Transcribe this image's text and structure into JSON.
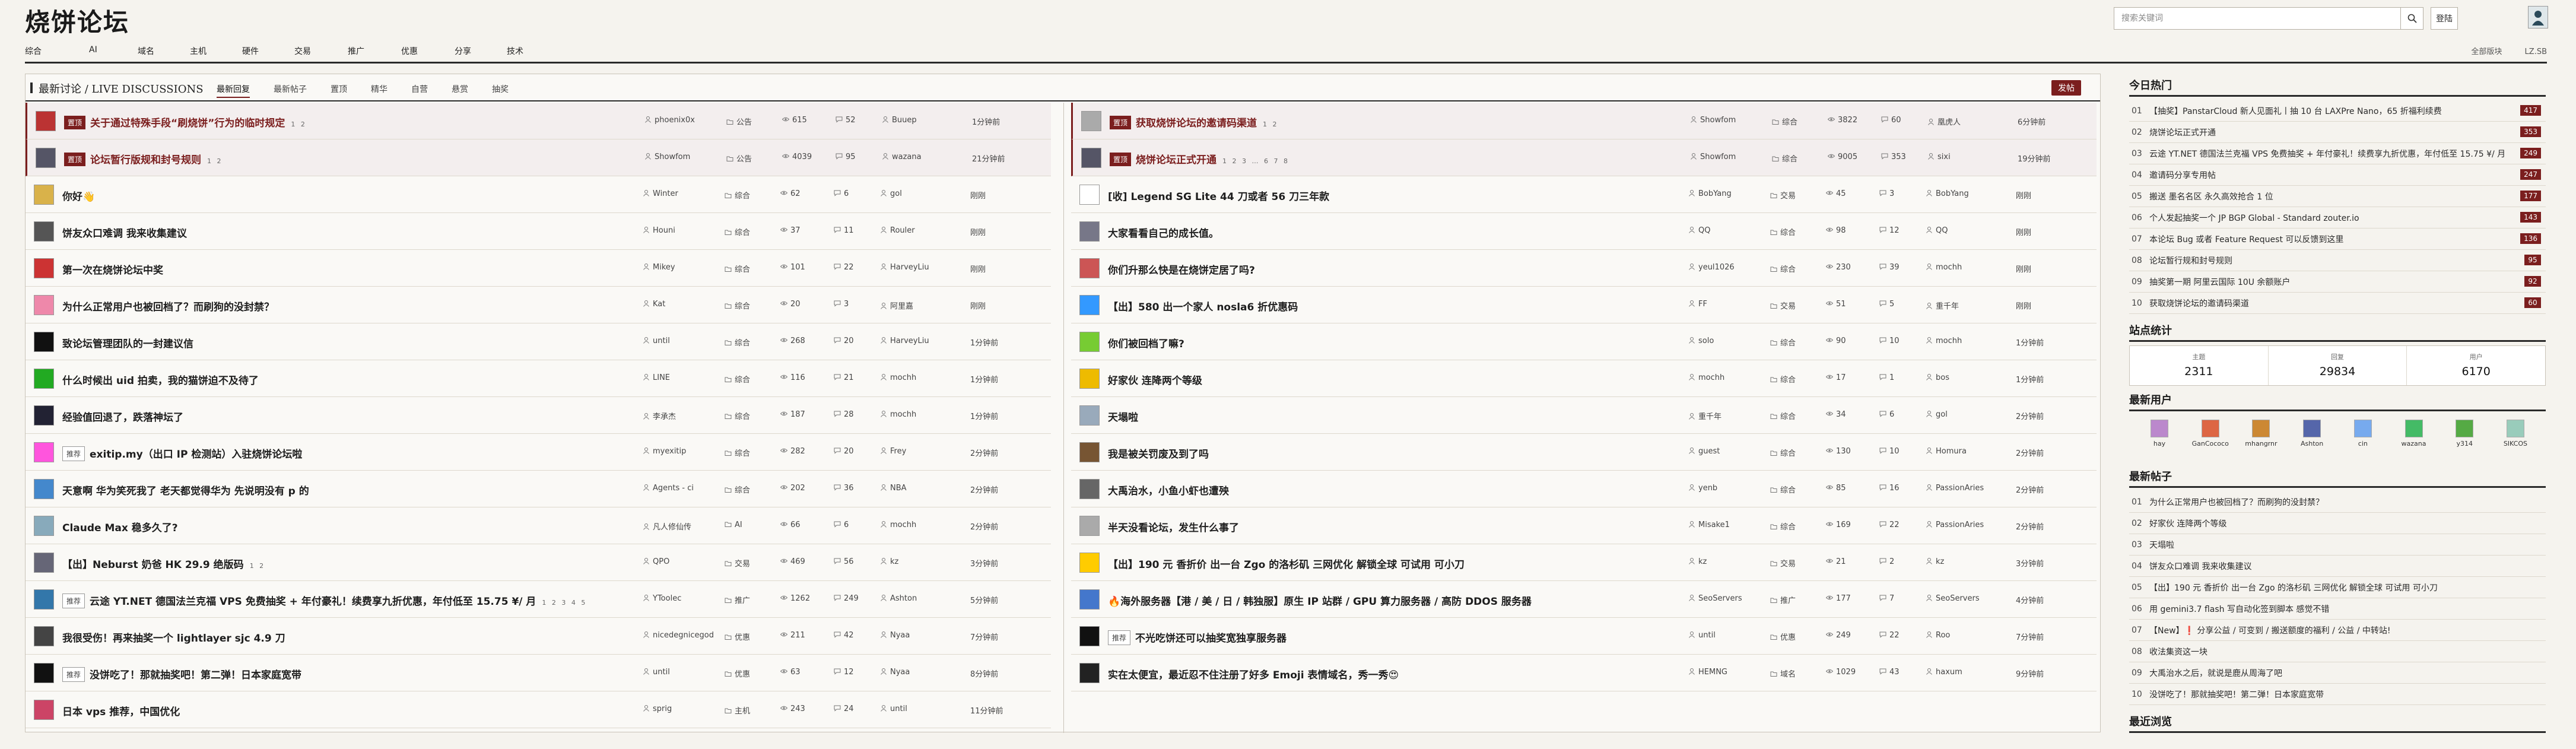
{
  "site": {
    "logo": "烧饼论坛"
  },
  "header": {
    "search_placeholder": "搜索关键词",
    "login": "登陆",
    "nav": [
      "综合",
      "AI",
      "域名",
      "主机",
      "硬件",
      "交易",
      "推广",
      "优惠",
      "分享",
      "技术"
    ],
    "right_links": [
      "全部版块",
      "LZ.SB"
    ]
  },
  "main": {
    "title": "最新讨论 / LIVE DISCUSSIONS",
    "tabs": [
      "最新回复",
      "最新帖子",
      "置顶",
      "精华",
      "自营",
      "悬赏",
      "抽奖"
    ],
    "active_tab": 0,
    "post_button": "发帖",
    "left_rows": [
      {
        "badge": "置顶",
        "pin": true,
        "title": "关于通过特殊手段“刷烧饼”行为的临时规定",
        "pages": "1 2",
        "user": "phoenix0x",
        "cat": "公告",
        "views": "615",
        "replies": "52",
        "last": "Buuep",
        "time": "1分钟前",
        "av": "#b33"
      },
      {
        "badge": "置顶",
        "pin": true,
        "title": "论坛暂行版规和封号规则",
        "pages": "1 2",
        "user": "Showfom",
        "cat": "公告",
        "views": "4039",
        "replies": "95",
        "last": "wazana",
        "time": "21分钟前",
        "av": "#556"
      },
      {
        "title": "你好👋",
        "user": "Winter",
        "cat": "综合",
        "views": "62",
        "replies": "6",
        "last": "gol",
        "time": "刚刚",
        "av": "#d9b24a"
      },
      {
        "title": "饼友众口难调 我来收集建议",
        "user": "Houni",
        "cat": "综合",
        "views": "37",
        "replies": "11",
        "last": "Rouler",
        "time": "刚刚",
        "av": "#555"
      },
      {
        "title": "第一次在烧饼论坛中奖",
        "user": "Mikey",
        "cat": "综合",
        "views": "101",
        "replies": "22",
        "last": "HarveyLiu",
        "time": "刚刚",
        "av": "#c33"
      },
      {
        "title": "为什么正常用户也被回档了？而刷狗的没封禁？",
        "user": "Kat",
        "cat": "综合",
        "views": "20",
        "replies": "3",
        "last": "阿里嘉",
        "time": "刚刚",
        "av": "#e8a"
      },
      {
        "title": "致论坛管理团队的一封建议信",
        "user": "until",
        "cat": "综合",
        "views": "268",
        "replies": "20",
        "last": "HarveyLiu",
        "time": "1分钟前",
        "av": "#111"
      },
      {
        "title": "什么时候出 uid 拍卖，我的猫饼迫不及待了",
        "user": "LINE",
        "cat": "综合",
        "views": "116",
        "replies": "21",
        "last": "mochh",
        "time": "1分钟前",
        "av": "#2a2"
      },
      {
        "title": "经验值回退了，跌落神坛了",
        "user": "李承杰",
        "cat": "综合",
        "views": "187",
        "replies": "28",
        "last": "mochh",
        "time": "1分钟前",
        "av": "#223"
      },
      {
        "badge": "推荐",
        "grey": true,
        "title": "exitip.my（出口 IP 检测站）入驻烧饼论坛啦",
        "user": "myexitip",
        "cat": "综合",
        "views": "282",
        "replies": "20",
        "last": "Frey",
        "time": "2分钟前",
        "av": "#f5d"
      },
      {
        "title": "天意啊 华为笑死我了 老天都觉得华为 先说明没有 p 的",
        "user": "Agents - ci",
        "cat": "综合",
        "views": "202",
        "replies": "36",
        "last": "NBA",
        "time": "2分钟前",
        "av": "#48c"
      },
      {
        "title": "Claude Max 稳多久了?",
        "user": "凡人修仙传",
        "cat": "AI",
        "views": "66",
        "replies": "6",
        "last": "mochh",
        "time": "2分钟前",
        "av": "#8ab"
      },
      {
        "title": "【出】Neburst 奶爸 HK 29.9 绝版码",
        "pages": "1 2",
        "user": "QPO",
        "cat": "交易",
        "views": "469",
        "replies": "56",
        "last": "kz",
        "time": "3分钟前",
        "av": "#667"
      },
      {
        "badge": "推荐",
        "grey": true,
        "title": "云途 YT.NET 德国法兰克福 VPS 免费抽奖 + 年付豪礼！续费享九折优惠，年付低至 15.75 ¥/ 月",
        "pages": "1 2 3 4 5",
        "user": "YToolec",
        "cat": "推广",
        "views": "1262",
        "replies": "249",
        "last": "Ashton",
        "time": "5分钟前",
        "av": "#37a"
      },
      {
        "title": "我很受伤！再来抽奖一个 lightlayer sjc 4.9 刀",
        "user": "nicedegnicegod",
        "cat": "优惠",
        "views": "211",
        "replies": "42",
        "last": "Nyaa",
        "time": "7分钟前",
        "av": "#444"
      },
      {
        "badge": "推荐",
        "grey": true,
        "title": "没饼吃了！那就抽奖吧！第二弹！日本家庭宽带",
        "user": "until",
        "cat": "优惠",
        "views": "63",
        "replies": "12",
        "last": "Nyaa",
        "time": "8分钟前",
        "av": "#111"
      },
      {
        "title": "日本 vps 推荐，中国优化",
        "user": "sprig",
        "cat": "主机",
        "views": "243",
        "replies": "24",
        "last": "until",
        "time": "11分钟前",
        "av": "#c46"
      }
    ],
    "right_rows": [
      {
        "badge": "置顶",
        "pin": true,
        "title": "获取烧饼论坛的邀请码渠道",
        "pages": "1 2",
        "user": "Showfom",
        "cat": "综合",
        "views": "3822",
        "replies": "60",
        "last": "凰虎人",
        "time": "6分钟前",
        "av": "#aaa"
      },
      {
        "badge": "置顶",
        "pin": true,
        "title": "烧饼论坛正式开通",
        "pages": "1 2 3 … 6 7 8",
        "user": "Showfom",
        "cat": "综合",
        "views": "9005",
        "replies": "353",
        "last": "sixi",
        "time": "19分钟前",
        "av": "#556"
      },
      {
        "title": "[收] Legend SG Lite 44 刀或者 56 刀三年款",
        "user": "BobYang",
        "cat": "交易",
        "views": "45",
        "replies": "3",
        "last": "BobYang",
        "time": "刚刚",
        "av": "#fff"
      },
      {
        "title": "大家看看自己的成长值。",
        "user": "QQ",
        "cat": "综合",
        "views": "98",
        "replies": "12",
        "last": "QQ",
        "time": "刚刚",
        "av": "#778"
      },
      {
        "title": "你们升那么快是在烧饼定居了吗?",
        "user": "yeul1026",
        "cat": "综合",
        "views": "230",
        "replies": "39",
        "last": "mochh",
        "time": "刚刚",
        "av": "#c55"
      },
      {
        "title": "【出】580 出一个家人 nosla6 折优惠码",
        "user": "FF",
        "cat": "交易",
        "views": "51",
        "replies": "5",
        "last": "重千年",
        "time": "刚刚",
        "av": "#39f"
      },
      {
        "title": "你们被回档了嘛?",
        "user": "solo",
        "cat": "综合",
        "views": "90",
        "replies": "10",
        "last": "mochh",
        "time": "1分钟前",
        "av": "#7c3"
      },
      {
        "title": "好家伙 连降两个等级",
        "user": "mochh",
        "cat": "综合",
        "views": "17",
        "replies": "1",
        "last": "bos",
        "time": "1分钟前",
        "av": "#eb0"
      },
      {
        "title": "天塌啦",
        "user": "重千年",
        "cat": "综合",
        "views": "34",
        "replies": "6",
        "last": "gol",
        "time": "2分钟前",
        "av": "#9ab"
      },
      {
        "title": "我是被关罚废及到了吗",
        "user": "guest",
        "cat": "综合",
        "views": "130",
        "replies": "10",
        "last": "Homura",
        "time": "2分钟前",
        "av": "#753"
      },
      {
        "title": "大禹治水，小鱼小虾也遭殃",
        "user": "yenb",
        "cat": "综合",
        "views": "85",
        "replies": "16",
        "last": "PassionAries",
        "time": "2分钟前",
        "av": "#666"
      },
      {
        "title": "半天没看论坛，发生什么事了",
        "user": "Misake1",
        "cat": "综合",
        "views": "169",
        "replies": "22",
        "last": "PassionAries",
        "time": "2分钟前",
        "av": "#aaa"
      },
      {
        "title": "【出】190 元 香折价 出一台 Zgo 的洛杉矶 三网优化 解锁全球 可试用 可小刀",
        "user": "kz",
        "cat": "交易",
        "views": "21",
        "replies": "2",
        "last": "kz",
        "time": "3分钟前",
        "av": "#fc0"
      },
      {
        "title": "🔥海外服务器【港 / 美 / 日 / 韩独服】原生 IP 站群 / GPU 算力服务器 / 高防 DDOS 服务器",
        "user": "SeoServers",
        "cat": "推广",
        "views": "177",
        "replies": "7",
        "last": "SeoServers",
        "time": "4分钟前",
        "av": "#47c"
      },
      {
        "badge": "推荐",
        "grey": true,
        "title": "不光吃饼还可以抽奖宽独享服务器",
        "user": "until",
        "cat": "优惠",
        "views": "249",
        "replies": "22",
        "last": "Roo",
        "time": "7分钟前",
        "av": "#111"
      },
      {
        "title": "实在太便宜，最近忍不住注册了好多 Emoji 表情域名，秀一秀😍",
        "user": "HEMNG",
        "cat": "域名",
        "views": "1029",
        "replies": "43",
        "last": "haxum",
        "time": "9分钟前",
        "av": "#222"
      }
    ]
  },
  "sidebar": {
    "hot_title": "今日热门",
    "hot": [
      {
        "n": "01",
        "t": "【抽奖】PanstarCloud 新人见面礼丨抽 10 台 LAXPre Nano，65 折福利续费",
        "c": "417"
      },
      {
        "n": "02",
        "t": "烧饼论坛正式开通",
        "c": "353"
      },
      {
        "n": "03",
        "t": "云途 YT.NET 德国法兰克福 VPS 免费抽奖 + 年付豪礼！续费享九折优惠，年付低至 15.75 ¥/ 月",
        "c": "249"
      },
      {
        "n": "04",
        "t": "邀请码分享专用帖",
        "c": "247"
      },
      {
        "n": "05",
        "t": "搬送 墨名名区 永久高效抢合 1 位",
        "c": "177"
      },
      {
        "n": "06",
        "t": "个人发起抽奖一个 JP BGP Global - Standard zouter.io",
        "c": "143"
      },
      {
        "n": "07",
        "t": "本论坛 Bug 或者 Feature Request 可以反馈到这里",
        "c": "136"
      },
      {
        "n": "08",
        "t": "论坛暂行规和封号规则",
        "c": "95"
      },
      {
        "n": "09",
        "t": "抽奖第一期 阿里云国际 10U 余额账户",
        "c": "92"
      },
      {
        "n": "10",
        "t": "获取烧饼论坛的邀请码渠道",
        "c": "60"
      }
    ],
    "stats_title": "站点统计",
    "stats": [
      {
        "l": "主题",
        "v": "2311"
      },
      {
        "l": "回复",
        "v": "29834"
      },
      {
        "l": "用户",
        "v": "6170"
      }
    ],
    "users_title": "最新用户",
    "users": [
      {
        "n": "hay",
        "c": "#b8c"
      },
      {
        "n": "GanCococo",
        "c": "#d64"
      },
      {
        "n": "mhangrnr",
        "c": "#c83"
      },
      {
        "n": "Ashton",
        "c": "#56a"
      },
      {
        "n": "cin",
        "c": "#7ae"
      },
      {
        "n": "wazana",
        "c": "#4b6"
      },
      {
        "n": "y314",
        "c": "#5a4"
      },
      {
        "n": "SIKCOS",
        "c": "#9cb"
      }
    ],
    "newposts_title": "最新帖子",
    "newposts": [
      {
        "n": "01",
        "t": "为什么正常用户也被回档了？而刷狗的没封禁？"
      },
      {
        "n": "02",
        "t": "好家伙 连降两个等级"
      },
      {
        "n": "03",
        "t": "天塌啦"
      },
      {
        "n": "04",
        "t": "饼友众口难调 我来收集建议"
      },
      {
        "n": "05",
        "t": "【出】190 元 香折价 出一台 Zgo 的洛杉矶 三网优化 解锁全球 可试用 可小刀"
      },
      {
        "n": "06",
        "t": "用 gemini3.7 flash 写自动化签到脚本 感觉不错"
      },
      {
        "n": "07",
        "t": "【New】❗ 分享公益 / 可变到 / 搬送额度的福利 / 公益 / 中转站!"
      },
      {
        "n": "08",
        "t": "收法集资这一块"
      },
      {
        "n": "09",
        "t": "大禹治水之后，就说是鹿从周海了吧"
      },
      {
        "n": "10",
        "t": "没饼吃了！那就抽奖吧！第二弹！日本家庭宽带"
      }
    ],
    "recent_title": "最近浏览"
  }
}
